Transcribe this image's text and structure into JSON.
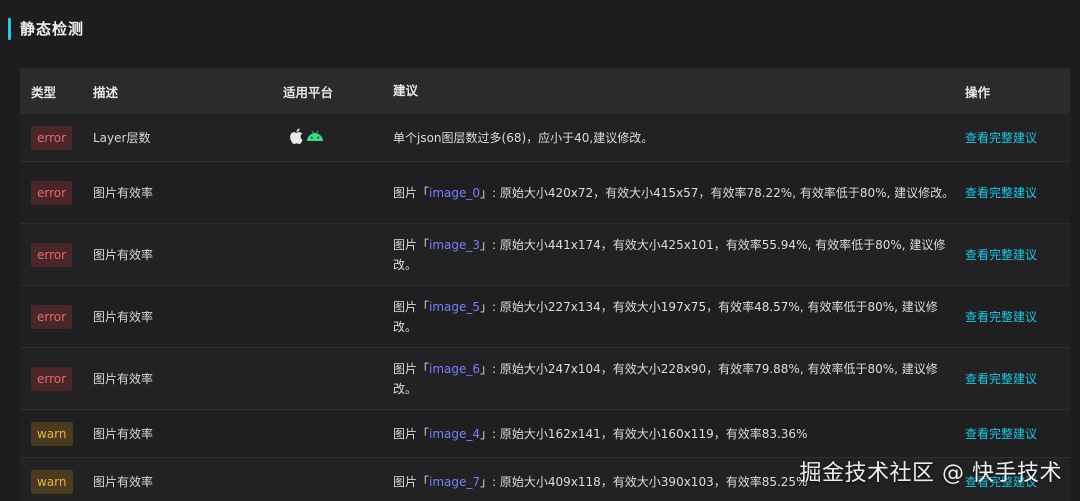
{
  "section": {
    "title": "静态检测"
  },
  "table": {
    "headers": {
      "type": "类型",
      "desc": "描述",
      "platform": "适用平台",
      "suggestion": "建议",
      "operation": "操作"
    },
    "rows": [
      {
        "type": "error",
        "desc": "Layer层数",
        "platform": true,
        "sugg_pre": "单个json图层数过多(68)，应小于40,建议修改。",
        "image": "",
        "sugg_post": "",
        "op": "查看完整建议"
      },
      {
        "type": "error",
        "desc": "图片有效率",
        "platform": false,
        "sugg_pre": "图片「",
        "image": "image_0",
        "sugg_post": "」: 原始大小420x72，有效大小415x57，有效率78.22%, 有效率低于80%, 建议修改。",
        "op": "查看完整建议"
      },
      {
        "type": "error",
        "desc": "图片有效率",
        "platform": false,
        "sugg_pre": "图片「",
        "image": "image_3",
        "sugg_post": "」: 原始大小441x174，有效大小425x101，有效率55.94%, 有效率低于80%, 建议修改。",
        "op": "查看完整建议"
      },
      {
        "type": "error",
        "desc": "图片有效率",
        "platform": false,
        "sugg_pre": "图片「",
        "image": "image_5",
        "sugg_post": "」: 原始大小227x134，有效大小197x75，有效率48.57%, 有效率低于80%, 建议修改。",
        "op": "查看完整建议"
      },
      {
        "type": "error",
        "desc": "图片有效率",
        "platform": false,
        "sugg_pre": "图片「",
        "image": "image_6",
        "sugg_post": "」: 原始大小247x104，有效大小228x90，有效率79.88%, 有效率低于80%, 建议修改。",
        "op": "查看完整建议"
      },
      {
        "type": "warn",
        "desc": "图片有效率",
        "platform": false,
        "sugg_pre": "图片「",
        "image": "image_4",
        "sugg_post": "」: 原始大小162x141，有效大小160x119，有效率83.36%",
        "op": "查看完整建议"
      },
      {
        "type": "warn",
        "desc": "图片有效率",
        "platform": false,
        "sugg_pre": "图片「",
        "image": "image_7",
        "sugg_post": "」: 原始大小409x118，有效大小390x103，有效率85.25%",
        "op": "查看完整建议"
      }
    ]
  },
  "watermark": "掘金技术社区 @ 快手技术",
  "colors": {
    "accent": "#27c9e8",
    "error": "#e46a6e",
    "warn": "#e8b052",
    "link": "#22c7e4",
    "image_name": "#7b7ef6"
  },
  "icons": {
    "platform": [
      "apple-icon",
      "android-icon"
    ]
  }
}
